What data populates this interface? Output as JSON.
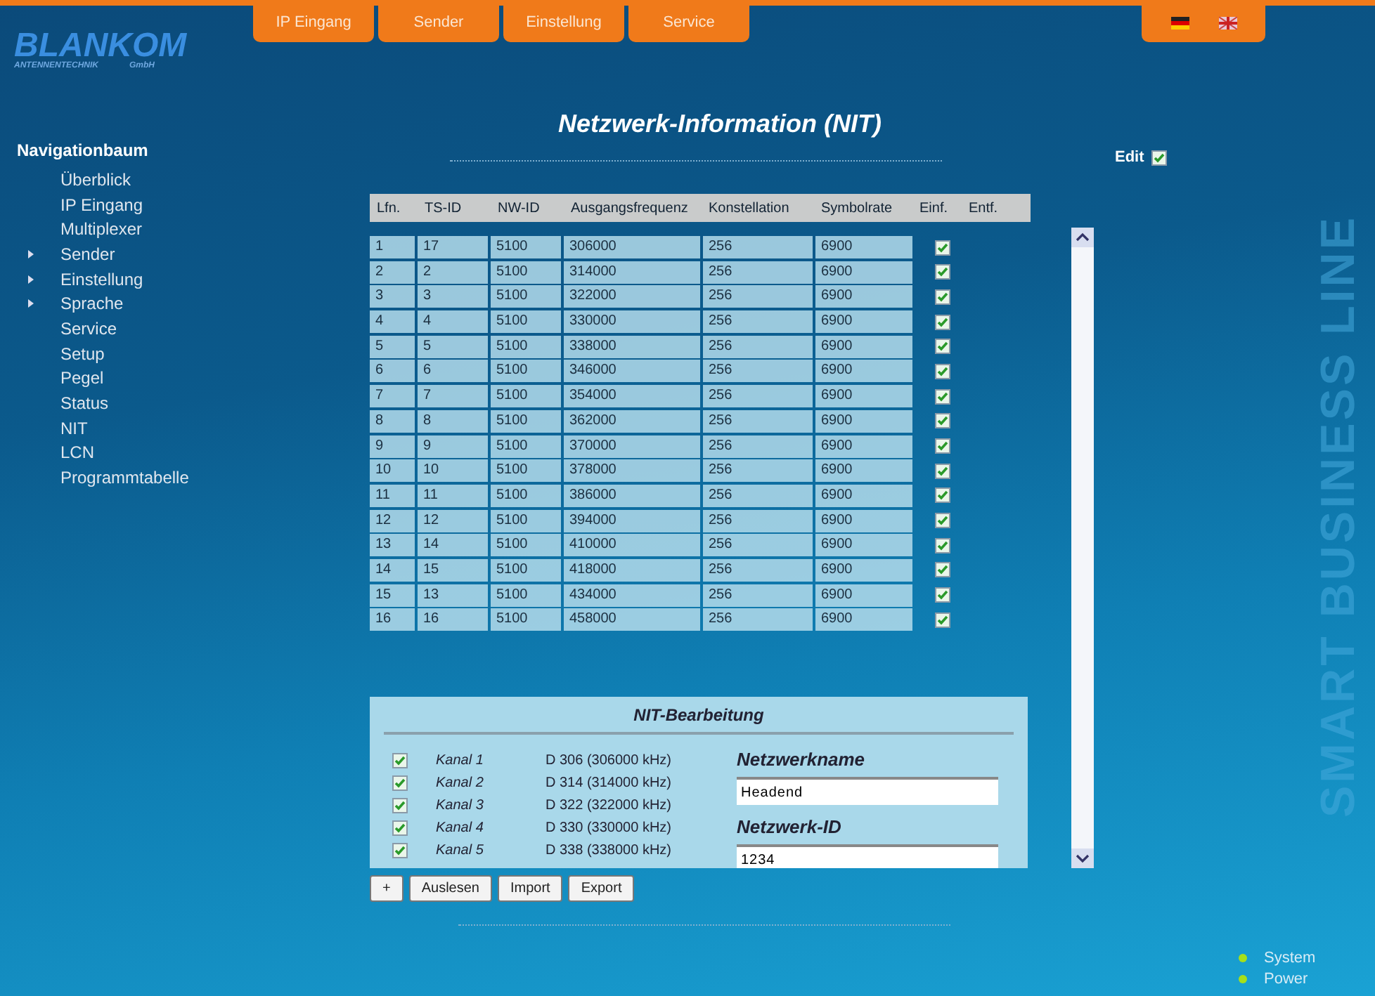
{
  "logo": {
    "name": "BLANKOM",
    "subtitle": "ANTENNENTECHNIK",
    "suffix": "GmbH"
  },
  "top_nav": {
    "tabs": [
      {
        "label": "IP Eingang"
      },
      {
        "label": "Sender"
      },
      {
        "label": "Einstellung"
      },
      {
        "label": "Service"
      }
    ]
  },
  "sidebar": {
    "title": "Navigationbaum",
    "items": [
      {
        "label": "Überblick",
        "expandable": false
      },
      {
        "label": "IP Eingang",
        "expandable": false
      },
      {
        "label": "Multiplexer",
        "expandable": false
      },
      {
        "label": "Sender",
        "expandable": true
      },
      {
        "label": "Einstellung",
        "expandable": true
      },
      {
        "label": "Sprache",
        "expandable": true
      },
      {
        "label": "Service",
        "expandable": false
      },
      {
        "label": "Setup",
        "expandable": false
      },
      {
        "label": "Pegel",
        "expandable": false
      },
      {
        "label": "Status",
        "expandable": false
      },
      {
        "label": "NIT",
        "expandable": false
      },
      {
        "label": "LCN",
        "expandable": false
      },
      {
        "label": "Programmtabelle",
        "expandable": false
      }
    ]
  },
  "title": "Netzwerk-Information (NIT)",
  "edit": {
    "label": "Edit",
    "checked": true
  },
  "table": {
    "columns": [
      "Lfn.",
      "TS-ID",
      "NW-ID",
      "Ausgangsfrequenz",
      "Konstellation",
      "Symbolrate",
      "Einf.",
      "Entf."
    ],
    "rows": [
      {
        "cells": [
          "1",
          "17",
          "5100",
          "306000",
          "256",
          "6900"
        ],
        "inserted": true
      },
      {
        "cells": [
          "2",
          "2",
          "5100",
          "314000",
          "256",
          "6900"
        ],
        "inserted": true
      },
      {
        "cells": [
          "3",
          "3",
          "5100",
          "322000",
          "256",
          "6900"
        ],
        "inserted": true
      },
      {
        "cells": [
          "4",
          "4",
          "5100",
          "330000",
          "256",
          "6900"
        ],
        "inserted": true
      },
      {
        "cells": [
          "5",
          "5",
          "5100",
          "338000",
          "256",
          "6900"
        ],
        "inserted": true
      },
      {
        "cells": [
          "6",
          "6",
          "5100",
          "346000",
          "256",
          "6900"
        ],
        "inserted": true
      },
      {
        "cells": [
          "7",
          "7",
          "5100",
          "354000",
          "256",
          "6900"
        ],
        "inserted": true
      },
      {
        "cells": [
          "8",
          "8",
          "5100",
          "362000",
          "256",
          "6900"
        ],
        "inserted": true
      },
      {
        "cells": [
          "9",
          "9",
          "5100",
          "370000",
          "256",
          "6900"
        ],
        "inserted": true
      },
      {
        "cells": [
          "10",
          "10",
          "5100",
          "378000",
          "256",
          "6900"
        ],
        "inserted": true
      },
      {
        "cells": [
          "11",
          "11",
          "5100",
          "386000",
          "256",
          "6900"
        ],
        "inserted": true
      },
      {
        "cells": [
          "12",
          "12",
          "5100",
          "394000",
          "256",
          "6900"
        ],
        "inserted": true
      },
      {
        "cells": [
          "13",
          "14",
          "5100",
          "410000",
          "256",
          "6900"
        ],
        "inserted": true
      },
      {
        "cells": [
          "14",
          "15",
          "5100",
          "418000",
          "256",
          "6900"
        ],
        "inserted": true
      },
      {
        "cells": [
          "15",
          "13",
          "5100",
          "434000",
          "256",
          "6900"
        ],
        "inserted": true
      },
      {
        "cells": [
          "16",
          "16",
          "5100",
          "458000",
          "256",
          "6900"
        ],
        "inserted": true
      }
    ]
  },
  "nit_edit": {
    "title": "NIT-Bearbeitung",
    "channels": [
      {
        "checked": true,
        "name": "Kanal 1",
        "frequency": "D 306 (306000 kHz)"
      },
      {
        "checked": true,
        "name": "Kanal 2",
        "frequency": "D 314 (314000 kHz)"
      },
      {
        "checked": true,
        "name": "Kanal 3",
        "frequency": "D 322 (322000 kHz)"
      },
      {
        "checked": true,
        "name": "Kanal 4",
        "frequency": "D 330 (330000 kHz)"
      },
      {
        "checked": true,
        "name": "Kanal 5",
        "frequency": "D 338 (338000 kHz)"
      }
    ],
    "fields": [
      {
        "label": "Netzwerkname",
        "value": "Headend"
      },
      {
        "label": "Netzwerk-ID",
        "value": "1234"
      }
    ]
  },
  "buttons": [
    "+",
    "Auslesen",
    "Import",
    "Export"
  ],
  "status": [
    {
      "label": "System",
      "color": "#a6e01a"
    },
    {
      "label": "Power",
      "color": "#a6e01a"
    }
  ],
  "brand": "SMART BUSINESS LINE"
}
